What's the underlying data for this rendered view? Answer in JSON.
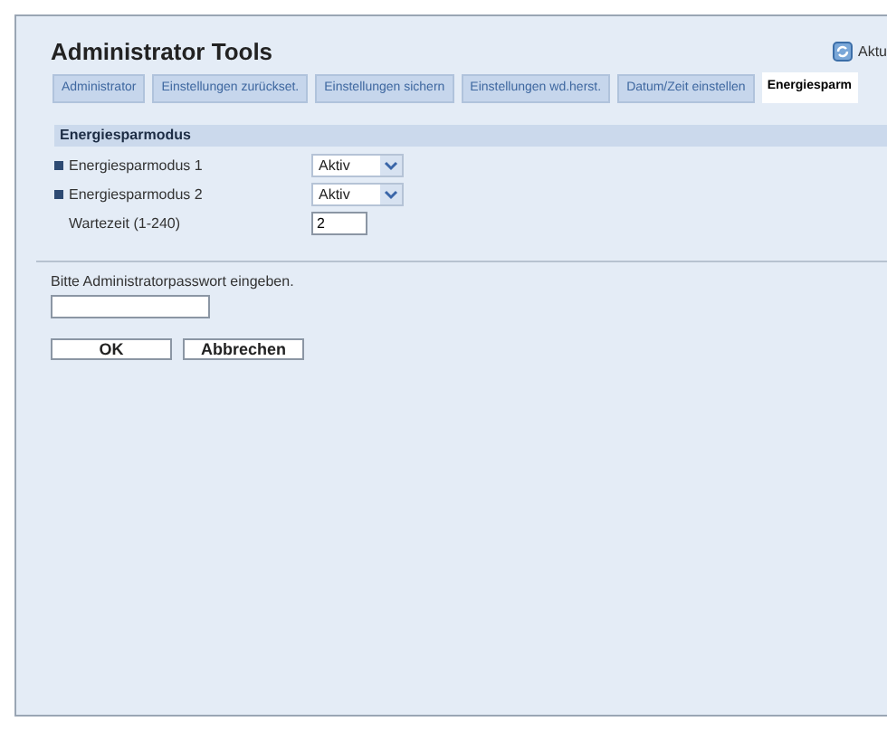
{
  "header": {
    "title": "Administrator Tools",
    "refresh_button": "Aktu"
  },
  "tabs": [
    {
      "label": "Administrator",
      "selected": false
    },
    {
      "label": "Einstellungen zurückset.",
      "selected": false
    },
    {
      "label": "Einstellungen sichern",
      "selected": false
    },
    {
      "label": "Einstellungen wd.herst.",
      "selected": false
    },
    {
      "label": "Datum/Zeit einstellen",
      "selected": false
    },
    {
      "label": "Energiesparm",
      "selected": true
    }
  ],
  "section": {
    "title": "Energiesparmodus",
    "rows": [
      {
        "label": "Energiesparmodus 1",
        "marked": true,
        "kind": "select",
        "value": "Aktiv"
      },
      {
        "label": "Energiesparmodus 2",
        "marked": true,
        "kind": "select",
        "value": "Aktiv"
      },
      {
        "label": "Wartezeit (1-240)",
        "marked": false,
        "kind": "text",
        "value": "2"
      }
    ]
  },
  "password": {
    "label": "Bitte Administratorpasswort eingeben."
  },
  "buttons": [
    "OK",
    "Abbrechen"
  ]
}
